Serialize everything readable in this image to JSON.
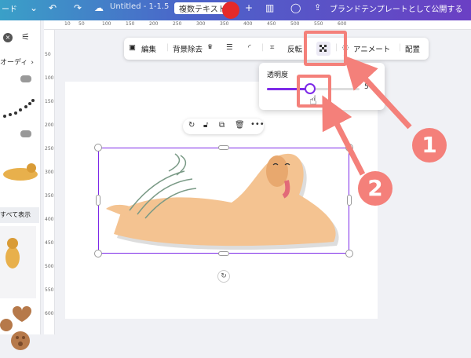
{
  "topbar": {
    "left_partial": "ード",
    "doc_title": "Untitled - 1-1.5",
    "text_btn": "複数テキスト",
    "publish_label": "ブランドテンプレートとして公開する"
  },
  "sidebar": {
    "audio_label": "オーディ",
    "see_all": "すべて表示"
  },
  "ruler": {
    "top": [
      "10",
      "50",
      "100",
      "150",
      "200",
      "250",
      "300",
      "350",
      "400",
      "450",
      "500",
      "550",
      "600"
    ],
    "left": [
      "50",
      "100",
      "150",
      "200",
      "250",
      "300",
      "350",
      "400",
      "450",
      "500",
      "550",
      "600"
    ]
  },
  "toolbar": {
    "edit": "編集",
    "bg_remove": "背景除去",
    "flip": "反転",
    "animate": "アニメート",
    "arrange": "配置"
  },
  "popup": {
    "transparency_label": "透明度",
    "value": "5"
  },
  "badges": [
    "1",
    "2"
  ],
  "colors": {
    "accent": "#7d2ae8",
    "highlight": "#f4807a"
  }
}
